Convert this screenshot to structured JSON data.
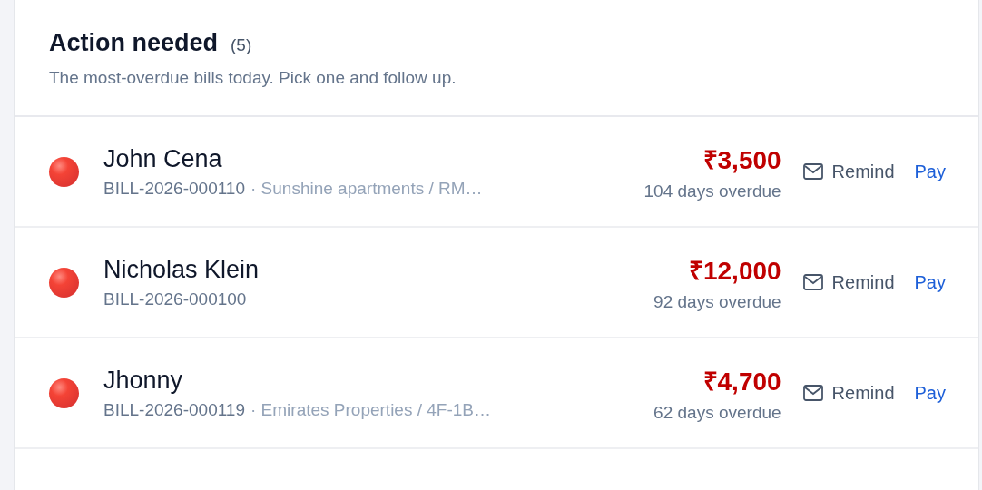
{
  "header": {
    "title": "Action needed",
    "count": "(5)",
    "subtitle": "The most-overdue bills today. Pick one and follow up."
  },
  "bills": [
    {
      "name": "John Cena",
      "bill": "BILL-2026-000110",
      "property": "· Sunshine apartments / RM…",
      "amount": "₹3,500",
      "overdue": "104 days overdue",
      "remind": "Remind",
      "pay": "Pay"
    },
    {
      "name": "Nicholas Klein",
      "bill": "BILL-2026-000100",
      "amount": "₹12,000",
      "overdue": "92 days overdue",
      "remind": "Remind",
      "pay": "Pay"
    },
    {
      "name": "Jhonny",
      "bill": "BILL-2026-000119",
      "property": "· Emirates Properties / 4F-1B…",
      "amount": "₹4,700",
      "overdue": "62 days overdue",
      "remind": "Remind",
      "pay": "Pay"
    }
  ]
}
